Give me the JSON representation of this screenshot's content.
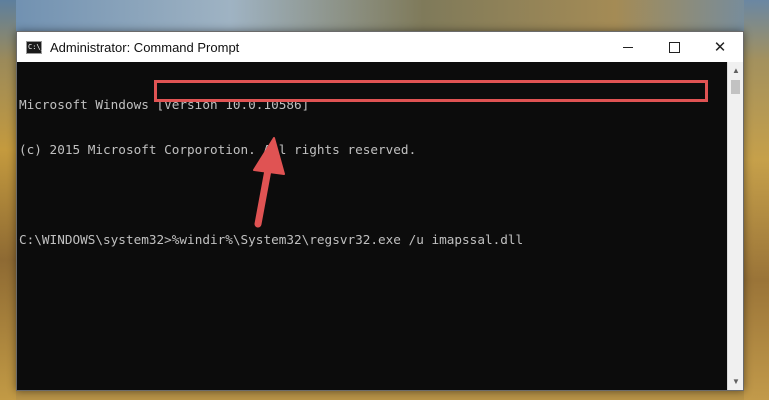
{
  "window": {
    "title": "Administrator: Command Prompt",
    "icon": "cmd-icon",
    "icon_text": "C:\\_",
    "controls": {
      "minimize": "minimize-icon",
      "maximize": "maximize-icon",
      "close": "close-icon",
      "close_glyph": "✕"
    }
  },
  "console": {
    "lines": [
      "Microsoft Windows [Version 10.0.10586]",
      "(c) 2015 Microsoft Corporotion. All rights reserved."
    ],
    "prompt": "C:\\WINDOWS\\system32>",
    "command": "%windir%\\System32\\regsvr32.exe /u imapssal.dll"
  },
  "annotation": {
    "highlight_color": "#e05353",
    "arrow_color": "#e05353"
  },
  "scrollbar": {
    "up_glyph": "▲",
    "down_glyph": "▼"
  }
}
